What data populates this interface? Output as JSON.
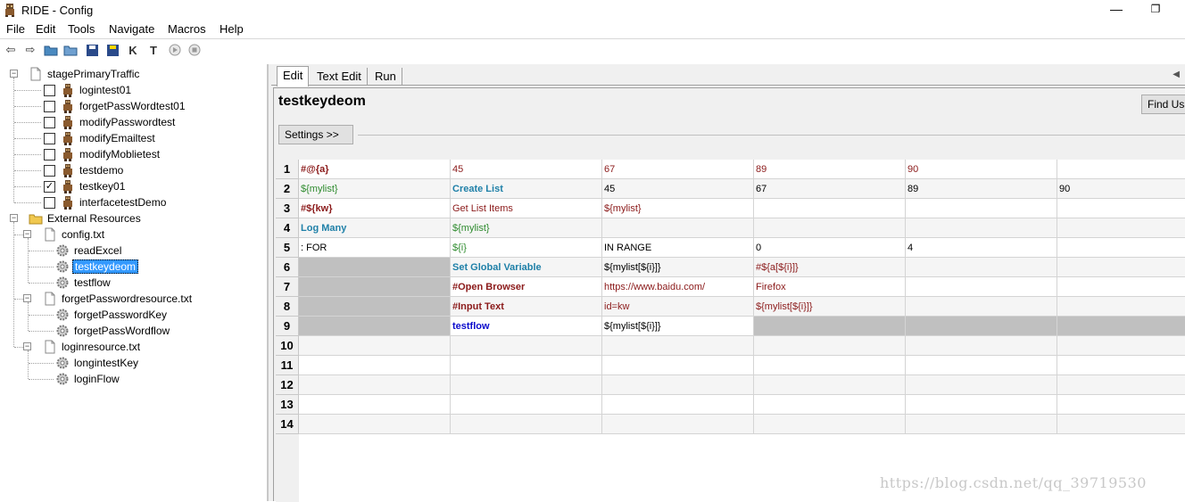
{
  "window": {
    "title": "RIDE - Config"
  },
  "menu": [
    "File",
    "Edit",
    "Tools",
    "Navigate",
    "Macros",
    "Help"
  ],
  "toolbar": {
    "icons": [
      "back-arrow-icon",
      "forward-arrow-icon",
      "open-test-suite-icon",
      "open-directory-icon",
      "save-icon",
      "save-all-icon",
      "search-keywords-icon",
      "search-tests-icon",
      "run-icon",
      "stop-icon"
    ],
    "search_keyword_label": "K",
    "search_test_label": "T"
  },
  "tree": {
    "suite": "stagePrimaryTraffic",
    "tests": [
      {
        "name": "logintest01",
        "checked": false
      },
      {
        "name": "forgetPassWordtest01",
        "checked": false
      },
      {
        "name": "modifyPasswordtest",
        "checked": false
      },
      {
        "name": "modifyEmailtest",
        "checked": false
      },
      {
        "name": "modifyMoblietest",
        "checked": false
      },
      {
        "name": "testdemo",
        "checked": false
      },
      {
        "name": "testkey01",
        "checked": true
      },
      {
        "name": "interfacetestDemo",
        "checked": false
      }
    ],
    "external_resources": "External Resources",
    "resources": [
      {
        "name": "config.txt",
        "keywords": [
          "readExcel",
          "testkeydeom",
          "testflow"
        ]
      },
      {
        "name": "forgetPasswordresource.txt",
        "keywords": [
          "forgetPasswordKey",
          "forgetPassWordflow"
        ]
      },
      {
        "name": "loginresource.txt",
        "keywords": [
          "longintestKey",
          "loginFlow"
        ]
      }
    ],
    "selected": "testkeydeom"
  },
  "tabs": [
    "Edit",
    "Text Edit",
    "Run"
  ],
  "editor": {
    "keyword_name": "testkeydeom",
    "find_usages": "Find Usa",
    "settings_button": "Settings >>"
  },
  "grid": {
    "row_numbers": [
      "1",
      "2",
      "3",
      "4",
      "5",
      "6",
      "7",
      "8",
      "9",
      "10",
      "11",
      "12",
      "13",
      "14"
    ],
    "rows": [
      [
        {
          "t": "#@{a}",
          "s": "c-dark"
        },
        {
          "t": "45",
          "s": "c-red"
        },
        {
          "t": "67",
          "s": "c-red"
        },
        {
          "t": "89",
          "s": "c-red"
        },
        {
          "t": "90",
          "s": "c-red"
        },
        {
          "t": "",
          "s": ""
        }
      ],
      [
        {
          "t": "${mylist}",
          "s": "c-green"
        },
        {
          "t": "Create List",
          "s": "c-teal"
        },
        {
          "t": "45",
          "s": "c-black"
        },
        {
          "t": "67",
          "s": "c-black"
        },
        {
          "t": "89",
          "s": "c-black"
        },
        {
          "t": "90",
          "s": "c-black"
        }
      ],
      [
        {
          "t": "#${kw}",
          "s": "c-dark"
        },
        {
          "t": "Get List Items",
          "s": "c-red"
        },
        {
          "t": "${mylist}",
          "s": "c-red"
        },
        {
          "t": "",
          "s": ""
        },
        {
          "t": "",
          "s": ""
        },
        {
          "t": "",
          "s": ""
        }
      ],
      [
        {
          "t": "Log Many",
          "s": "c-teal"
        },
        {
          "t": "${mylist}",
          "s": "c-green"
        },
        {
          "t": "",
          "s": ""
        },
        {
          "t": "",
          "s": ""
        },
        {
          "t": "",
          "s": ""
        },
        {
          "t": "",
          "s": ""
        }
      ],
      [
        {
          "t": ": FOR",
          "s": "c-black"
        },
        {
          "t": "${i}",
          "s": "c-green"
        },
        {
          "t": "IN RANGE",
          "s": "c-black"
        },
        {
          "t": "0",
          "s": "c-black"
        },
        {
          "t": "4",
          "s": "c-black"
        },
        {
          "t": "",
          "s": ""
        }
      ],
      [
        {
          "t": "",
          "s": "c-gray"
        },
        {
          "t": "Set Global Variable",
          "s": "c-teal"
        },
        {
          "t": "${mylist[${i}]}",
          "s": "c-black"
        },
        {
          "t": "#${a[${i}]}",
          "s": "c-red"
        },
        {
          "t": "",
          "s": ""
        },
        {
          "t": "",
          "s": ""
        }
      ],
      [
        {
          "t": "",
          "s": "c-gray"
        },
        {
          "t": "#Open Browser",
          "s": "c-dark"
        },
        {
          "t": "https://www.baidu.com/",
          "s": "c-red"
        },
        {
          "t": "Firefox",
          "s": "c-red"
        },
        {
          "t": "",
          "s": ""
        },
        {
          "t": "",
          "s": ""
        }
      ],
      [
        {
          "t": "",
          "s": "c-gray"
        },
        {
          "t": "#Input Text",
          "s": "c-dark"
        },
        {
          "t": "id=kw",
          "s": "c-red"
        },
        {
          "t": "${mylist[${i}]}",
          "s": "c-red"
        },
        {
          "t": "",
          "s": ""
        },
        {
          "t": "",
          "s": ""
        }
      ],
      [
        {
          "t": "",
          "s": "c-gray"
        },
        {
          "t": "testflow",
          "s": "c-blue"
        },
        {
          "t": "${mylist[${i}]}",
          "s": "c-black"
        },
        {
          "t": "",
          "s": "c-gray"
        },
        {
          "t": "",
          "s": "c-gray"
        },
        {
          "t": "",
          "s": "c-gray"
        }
      ],
      [
        {
          "t": "",
          "s": ""
        },
        {
          "t": "",
          "s": ""
        },
        {
          "t": "",
          "s": ""
        },
        {
          "t": "",
          "s": ""
        },
        {
          "t": "",
          "s": ""
        },
        {
          "t": "",
          "s": ""
        }
      ],
      [
        {
          "t": "",
          "s": ""
        },
        {
          "t": "",
          "s": ""
        },
        {
          "t": "",
          "s": ""
        },
        {
          "t": "",
          "s": ""
        },
        {
          "t": "",
          "s": ""
        },
        {
          "t": "",
          "s": ""
        }
      ],
      [
        {
          "t": "",
          "s": ""
        },
        {
          "t": "",
          "s": ""
        },
        {
          "t": "",
          "s": ""
        },
        {
          "t": "",
          "s": ""
        },
        {
          "t": "",
          "s": ""
        },
        {
          "t": "",
          "s": ""
        }
      ],
      [
        {
          "t": "",
          "s": ""
        },
        {
          "t": "",
          "s": ""
        },
        {
          "t": "",
          "s": ""
        },
        {
          "t": "",
          "s": ""
        },
        {
          "t": "",
          "s": ""
        },
        {
          "t": "",
          "s": ""
        }
      ],
      [
        {
          "t": "",
          "s": ""
        },
        {
          "t": "",
          "s": ""
        },
        {
          "t": "",
          "s": ""
        },
        {
          "t": "",
          "s": ""
        },
        {
          "t": "",
          "s": ""
        },
        {
          "t": "",
          "s": ""
        }
      ]
    ]
  },
  "watermark": "https://blog.csdn.net/qq_39719530"
}
